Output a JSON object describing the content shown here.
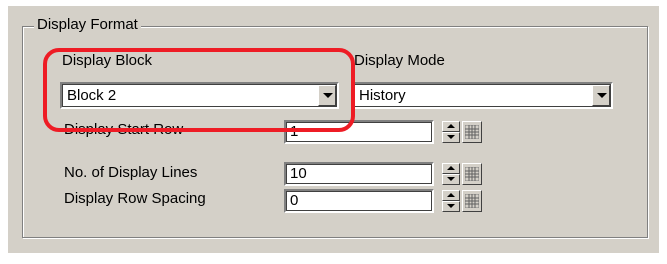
{
  "group": {
    "title": "Display Format"
  },
  "display_block": {
    "label": "Display Block",
    "value": "Block 2"
  },
  "display_mode": {
    "label": "Display Mode",
    "value": "History"
  },
  "start_row": {
    "label": "Display Start Row",
    "value": "1"
  },
  "display_lines": {
    "label": "No. of Display Lines",
    "value": "10"
  },
  "row_spacing": {
    "label": "Display Row Spacing",
    "value": "0"
  },
  "colors": {
    "panel": "#d4d0c8",
    "highlight": "#ee1c25"
  }
}
